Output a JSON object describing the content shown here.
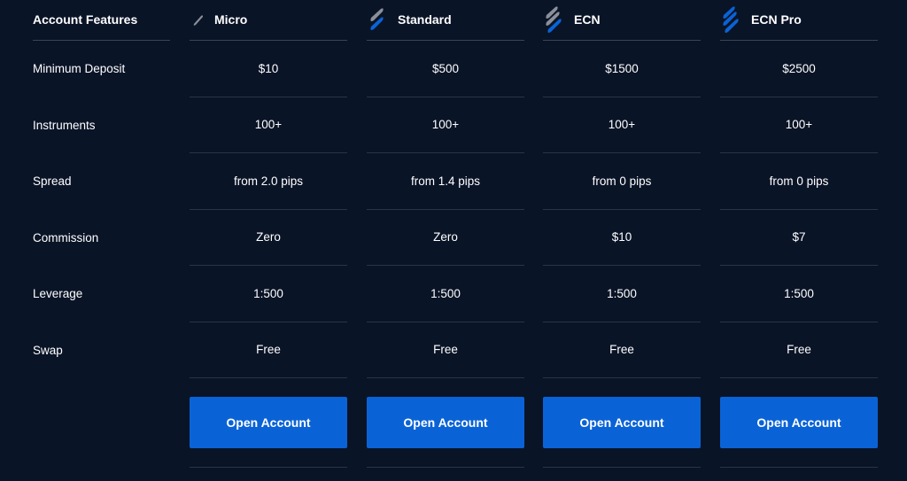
{
  "features": {
    "header": "Account Features",
    "rows": [
      "Minimum Deposit",
      "Instruments",
      "Spread",
      "Commission",
      "Leverage",
      "Swap"
    ]
  },
  "accounts": [
    {
      "name": "Micro",
      "icon": "micro-logo-icon",
      "values": [
        "$10",
        "100+",
        "from 2.0 pips",
        "Zero",
        "1:500",
        "Free"
      ],
      "button": "Open Account"
    },
    {
      "name": "Standard",
      "icon": "standard-logo-icon",
      "values": [
        "$500",
        "100+",
        "from 1.4 pips",
        "Zero",
        "1:500",
        "Free"
      ],
      "button": "Open Account"
    },
    {
      "name": "ECN",
      "icon": "ecn-logo-icon",
      "values": [
        "$1500",
        "100+",
        "from 0 pips",
        "$10",
        "1:500",
        "Free"
      ],
      "button": "Open Account"
    },
    {
      "name": "ECN Pro",
      "icon": "ecn-pro-logo-icon",
      "values": [
        "$2500",
        "100+",
        "from 0 pips",
        "$7",
        "1:500",
        "Free"
      ],
      "button": "Open Account"
    }
  ],
  "colors": {
    "background": "#0a1427",
    "accent": "#0a63d6",
    "logo_gray": "#8a8f99"
  }
}
